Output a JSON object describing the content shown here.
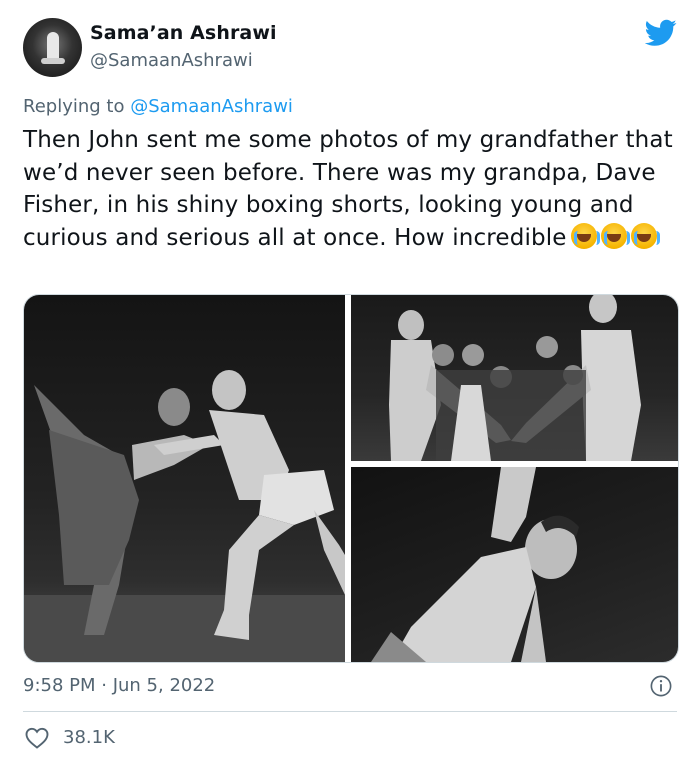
{
  "author": {
    "display_name": "Sama’an Ashrawi",
    "handle": "@SamaanAshrawi",
    "avatar_icon": "avatar-photo"
  },
  "brand": {
    "icon": "twitter-bird-icon",
    "color": "#1d9bf0"
  },
  "reply": {
    "prefix": "Replying to ",
    "mention": "@SamaanAshrawi"
  },
  "tweet": {
    "text": "Then John sent me some photos of my grandfather that we’d never seen before. There was my grandpa, Dave Fisher, in his shiny boxing shorts, looking young and curious and serious all at once. How incredible",
    "emojis": [
      "loudly-crying-face-emoji",
      "loudly-crying-face-emoji",
      "loudly-crying-face-emoji"
    ]
  },
  "media": {
    "count": 3,
    "photos": [
      {
        "subject": "black-and-white photo of two dancers on stage"
      },
      {
        "subject": "black-and-white photo of two shirtless men touching hands in front of a group"
      },
      {
        "subject": "black-and-white photo of a shirtless young man stretching one arm up"
      }
    ]
  },
  "meta": {
    "time": "9:58 PM",
    "separator": " · ",
    "date": "Jun 5, 2022",
    "info_icon": "info-icon"
  },
  "stats": {
    "likes": "38.1K",
    "like_icon": "heart-icon"
  },
  "colors": {
    "text": "#0f1419",
    "secondary": "#536471",
    "link": "#1d9bf0",
    "border": "#cfd9de"
  }
}
